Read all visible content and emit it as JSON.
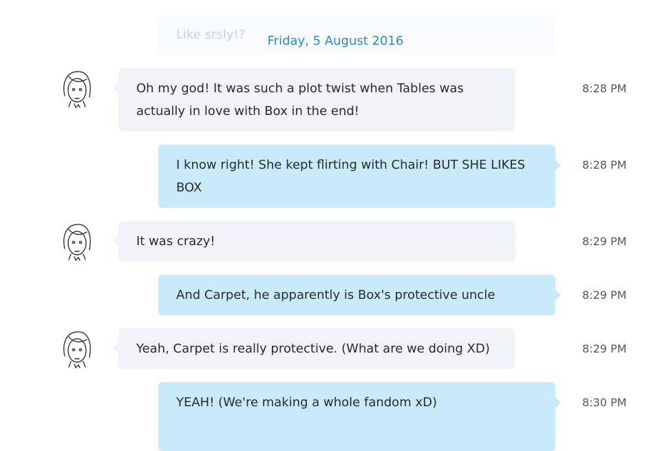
{
  "ghost_message": "Like srsly!?",
  "date_separator": "Friday, 5 August 2016",
  "messages": [
    {
      "direction": "in",
      "text": "Oh my god! It was such a plot twist when Tables was actually in love with Box in the end!",
      "time": "8:28 PM"
    },
    {
      "direction": "out",
      "text": "I know right! She kept flirting with Chair! BUT SHE LIKES BOX",
      "time": "8:28 PM"
    },
    {
      "direction": "in",
      "text": "It was crazy!",
      "time": "8:29 PM"
    },
    {
      "direction": "out",
      "text": "And Carpet, he apparently is Box's protective uncle",
      "time": "8:29 PM"
    },
    {
      "direction": "in",
      "text": "Yeah, Carpet is really protective. (What are we doing XD)",
      "time": "8:29 PM"
    },
    {
      "direction": "out",
      "text": "YEAH! (We're making a whole fandom xD)",
      "time": "8:30 PM"
    }
  ],
  "colors": {
    "incoming_bubble": "#f0f4f8",
    "outgoing_bubble": "#c8eaf9",
    "date_separator": "#2b8ac6"
  }
}
